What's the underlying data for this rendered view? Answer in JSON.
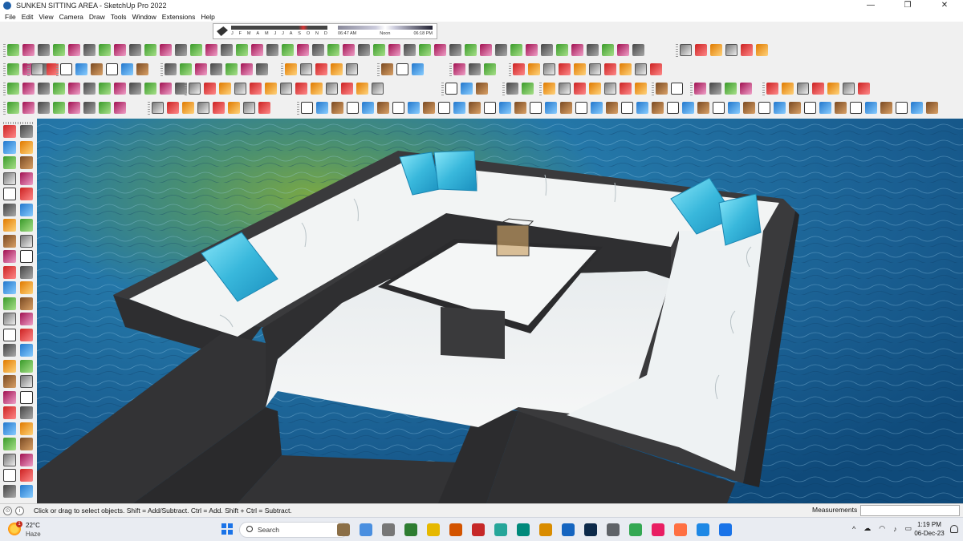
{
  "window": {
    "title": "SUNKEN SITTING AREA - SketchUp Pro 2022",
    "minimize": "—",
    "maximize": "❐",
    "close": "✕"
  },
  "menu": [
    "File",
    "Edit",
    "View",
    "Camera",
    "Draw",
    "Tools",
    "Window",
    "Extensions",
    "Help"
  ],
  "shadow_settings": {
    "months": [
      "J",
      "F",
      "M",
      "A",
      "M",
      "J",
      "J",
      "A",
      "S",
      "O",
      "N",
      "D"
    ],
    "time_start": "06:47 AM",
    "time_mid": "Noon",
    "time_end": "06:18 PM"
  },
  "status": {
    "hint": "Click or drag to select objects. Shift = Add/Subtract. Ctrl = Add. Shift + Ctrl = Subtract.",
    "measurements_label": "Measurements",
    "measurements_value": ""
  },
  "taskbar": {
    "weather_temp": "22°C",
    "weather_cond": "Haze",
    "weather_badge": "1",
    "search_placeholder": "Search",
    "time": "1:19 PM",
    "date": "06-Dec-23"
  },
  "colors": {
    "accent": "#1a73e8",
    "water": "#1e6e9e",
    "cushion": "#5fd0e8",
    "stone": "#3a3a3c",
    "seat": "#f2f4f4"
  }
}
